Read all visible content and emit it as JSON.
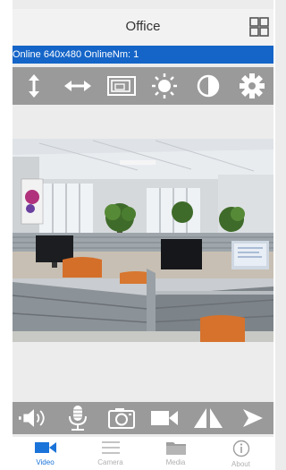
{
  "header": {
    "title": "Office"
  },
  "status": {
    "text": "Online 640x480 OnlineNm: 1"
  },
  "toolbar": {
    "items": [
      "vertical-flip-icon",
      "horizontal-flip-icon",
      "resolution-icon",
      "brightness-icon",
      "contrast-icon",
      "settings-icon"
    ]
  },
  "controls": {
    "items": [
      "speaker-icon",
      "microphone-icon",
      "snapshot-icon",
      "record-icon",
      "mirror-icon",
      "play-icon"
    ]
  },
  "tabs": [
    {
      "label": "Video",
      "active": true
    },
    {
      "label": "Camera",
      "active": false
    },
    {
      "label": "Media",
      "active": false
    },
    {
      "label": "About",
      "active": false
    }
  ],
  "colors": {
    "accent": "#1565c8",
    "toolbar": "#9a9a9a",
    "active_tab": "#1a73d9"
  }
}
